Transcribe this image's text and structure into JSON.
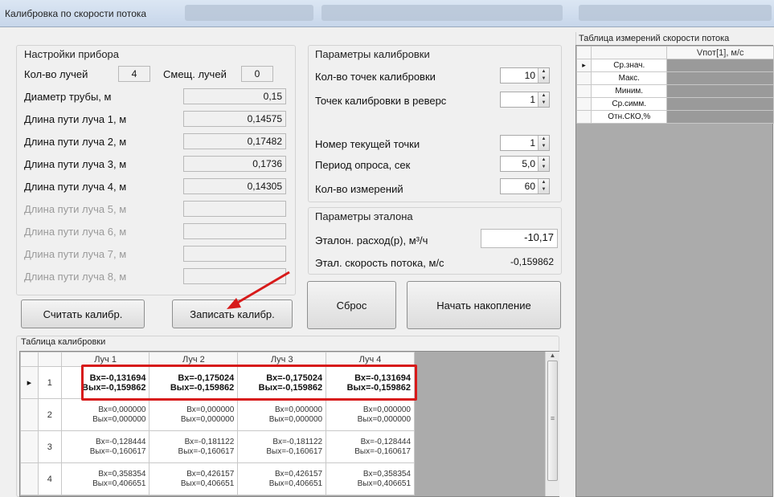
{
  "window": {
    "title": "Калибровка по скорости потока"
  },
  "device": {
    "group_title": "Настройки прибора",
    "beams_label": "Кол-во лучей",
    "beams_value": "4",
    "offset_label": "Смещ. лучей",
    "offset_value": "0",
    "pipe_label": "Диаметр трубы, м",
    "pipe_value": "0,15",
    "paths": [
      {
        "label": "Длина пути луча 1, м",
        "value": "0,14575"
      },
      {
        "label": "Длина пути луча 2, м",
        "value": "0,17482"
      },
      {
        "label": "Длина пути луча 3, м",
        "value": "0,1736"
      },
      {
        "label": "Длина пути луча 4, м",
        "value": "0,14305"
      },
      {
        "label": "Длина пути луча 5, м",
        "value": ""
      },
      {
        "label": "Длина пути луча 6, м",
        "value": ""
      },
      {
        "label": "Длина пути луча 7, м",
        "value": ""
      },
      {
        "label": "Длина пути луча 8, м",
        "value": ""
      }
    ]
  },
  "calib": {
    "group_title": "Параметры калибровки",
    "points_label": "Кол-во точек калибровки",
    "points_value": "10",
    "reverse_label": "Точек калибровки в реверс",
    "reverse_value": "1",
    "current_label": "Номер текущей точки",
    "current_value": "1",
    "period_label": "Период опроса, сек",
    "period_value": "5,0",
    "meas_label": "Кол-во измерений",
    "meas_value": "60"
  },
  "ref": {
    "group_title": "Параметры эталона",
    "flow_label": "Эталон. расход(р), м³/ч",
    "flow_value": "-10,17",
    "speed_label": "Этал. скорость потока, м/с",
    "speed_value": "-0,159862"
  },
  "buttons": {
    "read": "Считать калибр.",
    "write": "Записать калибр.",
    "reset": "Сброс",
    "start": "Начать накопление"
  },
  "calib_table": {
    "title": "Таблица калибровки",
    "columns": [
      "Луч 1",
      "Луч 2",
      "Луч 3",
      "Луч 4"
    ],
    "rows": [
      {
        "num": "1",
        "cells": [
          [
            "Вх=-0,131694",
            "Вых=-0,159862"
          ],
          [
            "Вх=-0,175024",
            "Вых=-0,159862"
          ],
          [
            "Вх=-0,175024",
            "Вых=-0,159862"
          ],
          [
            "Вх=-0,131694",
            "Вых=-0,159862"
          ]
        ]
      },
      {
        "num": "2",
        "cells": [
          [
            "Вх=0,000000",
            "Вых=0,000000"
          ],
          [
            "Вх=0,000000",
            "Вых=0,000000"
          ],
          [
            "Вх=0,000000",
            "Вых=0,000000"
          ],
          [
            "Вх=0,000000",
            "Вых=0,000000"
          ]
        ]
      },
      {
        "num": "3",
        "cells": [
          [
            "Вх=-0,128444",
            "Вых=-0,160617"
          ],
          [
            "Вх=-0,181122",
            "Вых=-0,160617"
          ],
          [
            "Вх=-0,181122",
            "Вых=-0,160617"
          ],
          [
            "Вх=-0,128444",
            "Вых=-0,160617"
          ]
        ]
      },
      {
        "num": "4",
        "cells": [
          [
            "Вх=0,358354",
            "Вых=0,406651"
          ],
          [
            "Вх=0,426157",
            "Вых=0,406651"
          ],
          [
            "Вх=0,426157",
            "Вых=0,406651"
          ],
          [
            "Вх=0,358354",
            "Вых=0,406651"
          ]
        ]
      }
    ]
  },
  "meas_table": {
    "title": "Таблица измерений скорости потока",
    "column": "Vпот[1], м/с",
    "rows": [
      "Ср.знач.",
      "Макс.",
      "Миним.",
      "Ср.симм.",
      "Отн.СКО,%"
    ]
  },
  "colors": {
    "highlight": "#d71a1a",
    "grid_bg": "#ababab"
  }
}
